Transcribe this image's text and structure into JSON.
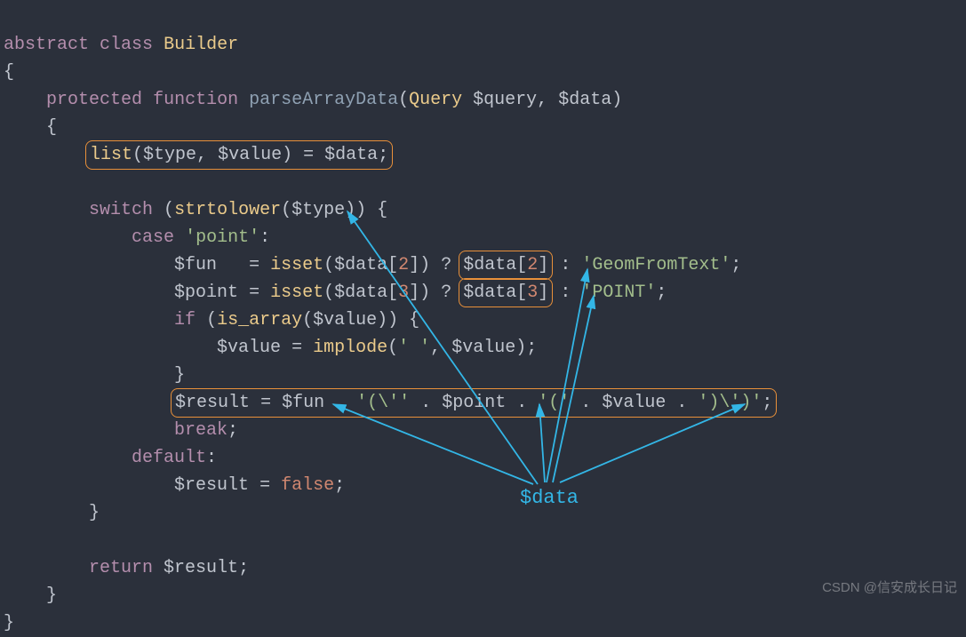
{
  "code": {
    "l1_abstract": "abstract",
    "l1_class": "class",
    "l1_builder": "Builder",
    "l2_brace": "{",
    "l3_protected": "protected",
    "l3_function": "function",
    "l3_name": "parseArrayData",
    "l3_query": "Query",
    "l3_p1": "$query",
    "l3_p2": "$data",
    "l4_brace": "{",
    "l5_list": "list",
    "l5_type": "$type",
    "l5_value": "$value",
    "l5_assign": "=",
    "l5_data": "$data",
    "l7_switch": "switch",
    "l7_strtolower": "strtolower",
    "l7_type": "$type",
    "l8_case": "case",
    "l8_point": "'point'",
    "l9_fun": "$fun",
    "l9_isset1": "isset",
    "l9_data2a": "$data",
    "l9_n2a": "2",
    "l9_data2b": "$data",
    "l9_n2b": "2",
    "l9_geom": "'GeomFromText'",
    "l10_point": "$point",
    "l10_isset2": "isset",
    "l10_data3a": "$data",
    "l10_n3a": "3",
    "l10_data3b": "$data",
    "l10_n3b": "3",
    "l10_pointstr": "'POINT'",
    "l11_if": "if",
    "l11_isarray": "is_array",
    "l11_value": "$value",
    "l12_value1": "$value",
    "l12_implode": "implode",
    "l12_sp": "' '",
    "l12_value2": "$value",
    "l13_brace": "}",
    "l14_result": "$result",
    "l14_fun": "$fun",
    "l14_s1": "'(\\''",
    "l14_pointv": "$point",
    "l14_s2": "'('",
    "l14_value": "$value",
    "l14_s3": "')\\')'",
    "l15_break": "break",
    "l16_default": "default",
    "l17_result": "$result",
    "l17_false": "false",
    "l18_brace": "}",
    "l20_return": "return",
    "l20_result": "$result",
    "l21_brace": "}",
    "l22_brace": "}"
  },
  "annotation_label": "$data",
  "watermark": "CSDN @信安成长日记"
}
